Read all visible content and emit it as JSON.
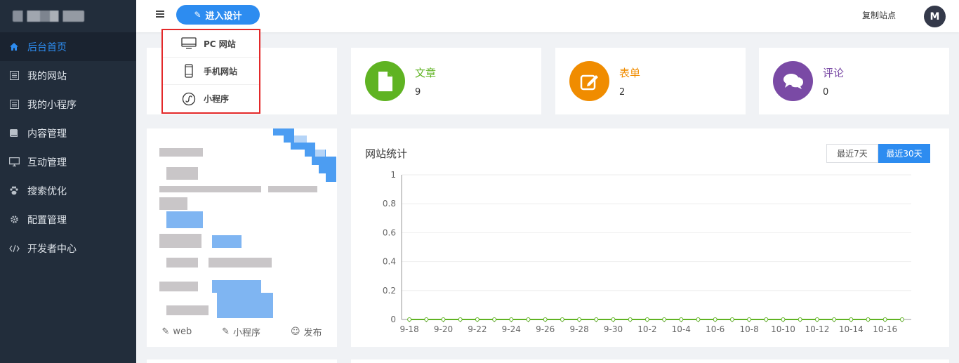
{
  "sidebar": {
    "items": [
      {
        "label": "后台首页",
        "icon": "home-icon",
        "active": true
      },
      {
        "label": "我的网站",
        "icon": "list-icon"
      },
      {
        "label": "我的小程序",
        "icon": "list-icon"
      },
      {
        "label": "内容管理",
        "icon": "book-icon"
      },
      {
        "label": "互动管理",
        "icon": "monitor-icon"
      },
      {
        "label": "搜索优化",
        "icon": "paw-icon"
      },
      {
        "label": "配置管理",
        "icon": "gear-icon"
      },
      {
        "label": "开发者中心",
        "icon": "code-icon"
      }
    ]
  },
  "header": {
    "design_button": "进入设计",
    "copy_site": "复制站点",
    "avatar_initial": "M"
  },
  "dropdown": {
    "items": [
      {
        "label": "PC 网站",
        "icon": "desktop-icon"
      },
      {
        "label": "手机网站",
        "icon": "mobile-icon"
      },
      {
        "label": "小程序",
        "icon": "miniprogram-icon"
      }
    ]
  },
  "stats": [
    {
      "title": "文章",
      "count": "9",
      "color": "#5fb322",
      "icon": "file-icon"
    },
    {
      "title": "表单",
      "count": "2",
      "color": "#f08c00",
      "icon": "edit-icon"
    },
    {
      "title": "评论",
      "count": "0",
      "color": "#7a4aa5",
      "icon": "comments-icon"
    }
  ],
  "site_card": {
    "actions": [
      "web",
      "小程序",
      "发布"
    ]
  },
  "chart_panel": {
    "title": "网站统计",
    "range_options": [
      "最近7天",
      "最近30天"
    ],
    "range_selected": "最近30天"
  },
  "chart_data": {
    "type": "line",
    "x": [
      "9-18",
      "9-19",
      "9-20",
      "9-21",
      "9-22",
      "9-23",
      "9-24",
      "9-25",
      "9-26",
      "9-27",
      "9-28",
      "9-29",
      "9-30",
      "10-1",
      "10-2",
      "10-3",
      "10-4",
      "10-5",
      "10-6",
      "10-7",
      "10-8",
      "10-9",
      "10-10",
      "10-11",
      "10-12",
      "10-13",
      "10-14",
      "10-15",
      "10-16",
      "10-17"
    ],
    "x_tick_labels": [
      "9-18",
      "9-20",
      "9-22",
      "9-24",
      "9-26",
      "9-28",
      "9-30",
      "10-2",
      "10-4",
      "10-6",
      "10-8",
      "10-10",
      "10-12",
      "10-14",
      "10-16"
    ],
    "y_ticks": [
      "0",
      "0.2",
      "0.4",
      "0.6",
      "0.8",
      "1"
    ],
    "ylim": [
      0,
      1
    ],
    "series": [
      {
        "values": [
          0,
          0,
          0,
          0,
          0,
          0,
          0,
          0,
          0,
          0,
          0,
          0,
          0,
          0,
          0,
          0,
          0,
          0,
          0,
          0,
          0,
          0,
          0,
          0,
          0,
          0,
          0,
          0,
          0,
          0
        ],
        "color": "#5fb322"
      }
    ],
    "grid": true
  }
}
